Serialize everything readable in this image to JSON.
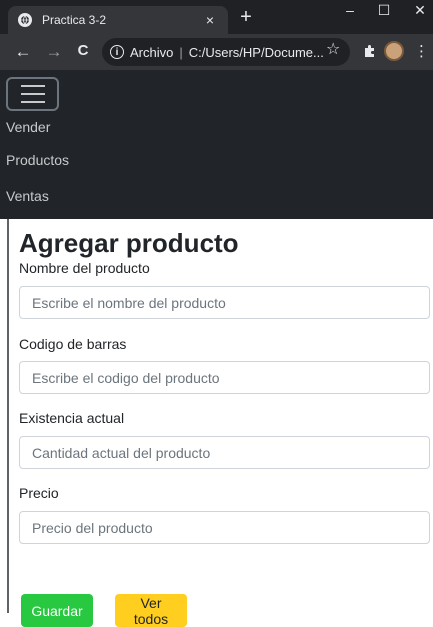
{
  "browser": {
    "tab_title": "Practica 3-2",
    "tab_close": "×",
    "new_tab": "+",
    "win_minimize": "–",
    "win_maximize": "☐",
    "win_close": "✕",
    "back": "←",
    "forward": "→",
    "reload": "C",
    "omnibox_label": "Archivo",
    "omnibox_url": "C:/Users/HP/Docume...",
    "star": "☆",
    "menu": "⋮"
  },
  "navbar": {
    "links": [
      "Vender",
      "Productos",
      "Ventas"
    ]
  },
  "form": {
    "title": "Agregar producto",
    "fields": [
      {
        "label": "Nombre del producto",
        "placeholder": "Escribe el nombre del producto"
      },
      {
        "label": "Codigo de barras",
        "placeholder": "Escribe el codigo del producto"
      },
      {
        "label": "Existencia actual",
        "placeholder": "Cantidad actual del producto"
      },
      {
        "label": "Precio",
        "placeholder": "Precio del producto"
      }
    ],
    "save_label": "Guardar",
    "view_all_label": "Ver todos"
  },
  "colors": {
    "navbar_bg": "#212529",
    "save_button": "#28c840",
    "view_all_button": "#ffce1f"
  }
}
